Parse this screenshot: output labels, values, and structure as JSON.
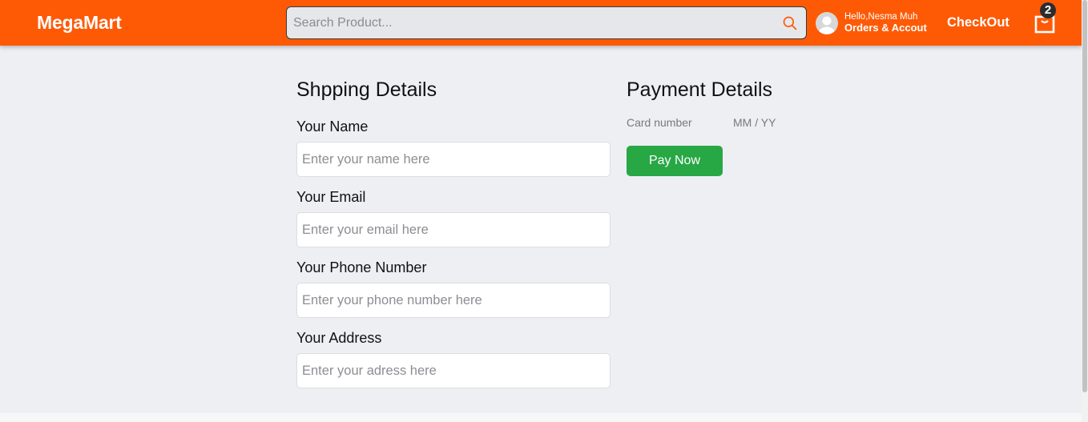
{
  "header": {
    "brand": "MegaMart",
    "search": {
      "placeholder": "Search Product...",
      "value": ""
    },
    "user": {
      "greeting": "Hello,Nesma Muh",
      "orders_label": "Orders & Accout"
    },
    "checkout_label": "CheckOut",
    "cart_count": "2"
  },
  "shipping": {
    "title": "Shpping Details",
    "fields": [
      {
        "label": "Your Name",
        "placeholder": "Enter your name here",
        "value": ""
      },
      {
        "label": "Your Email",
        "placeholder": "Enter your email here",
        "value": ""
      },
      {
        "label": "Your Phone Number",
        "placeholder": "Enter your phone number here",
        "value": ""
      },
      {
        "label": "Your Address",
        "placeholder": "Enter your adress here",
        "value": ""
      }
    ]
  },
  "payment": {
    "title": "Payment Details",
    "card_number_placeholder": "Card number",
    "expiry_placeholder": "MM / YY",
    "pay_button": "Pay Now"
  },
  "colors": {
    "brand_orange": "#fe5a06",
    "pay_green": "#28a745",
    "page_background": "#eeeff3",
    "cart_badge": "#2c2c2e"
  },
  "icons": [
    "search-icon",
    "user-avatar-icon",
    "shopping-bag-icon"
  ]
}
